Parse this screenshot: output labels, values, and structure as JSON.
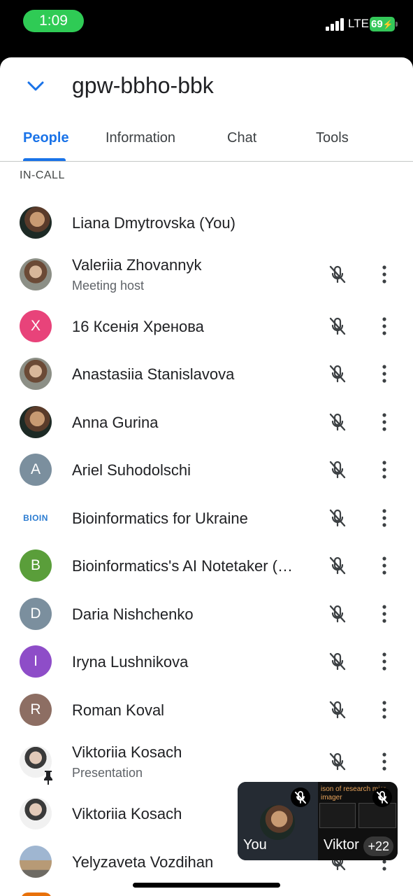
{
  "status_bar": {
    "time": "1:09",
    "network": "LTE",
    "battery": "69"
  },
  "header": {
    "meeting_code": "gpw-bbho-bbk"
  },
  "tabs": [
    {
      "label": "People",
      "active": true
    },
    {
      "label": "Information",
      "active": false
    },
    {
      "label": "Chat",
      "active": false
    },
    {
      "label": "Tools",
      "active": false
    }
  ],
  "section_label": "IN-CALL",
  "participants": [
    {
      "name": "Liana Dmytrovska (You)",
      "avatar": "photo",
      "muted": false
    },
    {
      "name": "Valeriia Zhovannyk",
      "subtitle": "Meeting host",
      "avatar": "photo",
      "muted": true
    },
    {
      "name": "16 Ксенія Хренова",
      "avatar_letter": "X",
      "avatar_color": "#e8437a",
      "muted": true
    },
    {
      "name": "Anastasiia Stanislavova",
      "avatar": "photo",
      "muted": true
    },
    {
      "name": "Anna Gurina",
      "avatar": "photo",
      "muted": true
    },
    {
      "name": "Ariel Suhodolschi",
      "avatar_letter": "A",
      "avatar_color": "#7b8f9e",
      "muted": true
    },
    {
      "name": "Bioinformatics for Ukraine",
      "avatar_logo": "BIOIN",
      "muted": true
    },
    {
      "name": "Bioinformatics's AI Notetaker (…",
      "avatar_letter": "B",
      "avatar_color": "#5a9e3a",
      "muted": true
    },
    {
      "name": "Daria Nishchenko",
      "avatar_letter": "D",
      "avatar_color": "#7b8f9e",
      "muted": true
    },
    {
      "name": "Iryna Lushnikova",
      "avatar_letter": "I",
      "avatar_color": "#8e4dc8",
      "muted": true
    },
    {
      "name": "Roman Koval",
      "avatar_letter": "R",
      "avatar_color": "#8d6e63",
      "muted": true
    },
    {
      "name": "Viktoriia Kosach",
      "subtitle": "Presentation",
      "avatar": "photo",
      "muted": true,
      "pinned": true
    },
    {
      "name": "Viktoriia Kosach",
      "avatar": "photo",
      "muted": false
    },
    {
      "name": "Yelyzaveta Vozdihan",
      "avatar": "photo",
      "muted": true
    }
  ],
  "pip": {
    "self_label": "You",
    "share_label": "Viktor",
    "share_text": "ison of research micr\nimager",
    "more_count": "+22"
  },
  "colors": {
    "accent": "#1a73e8",
    "status_green": "#2fcb55"
  }
}
